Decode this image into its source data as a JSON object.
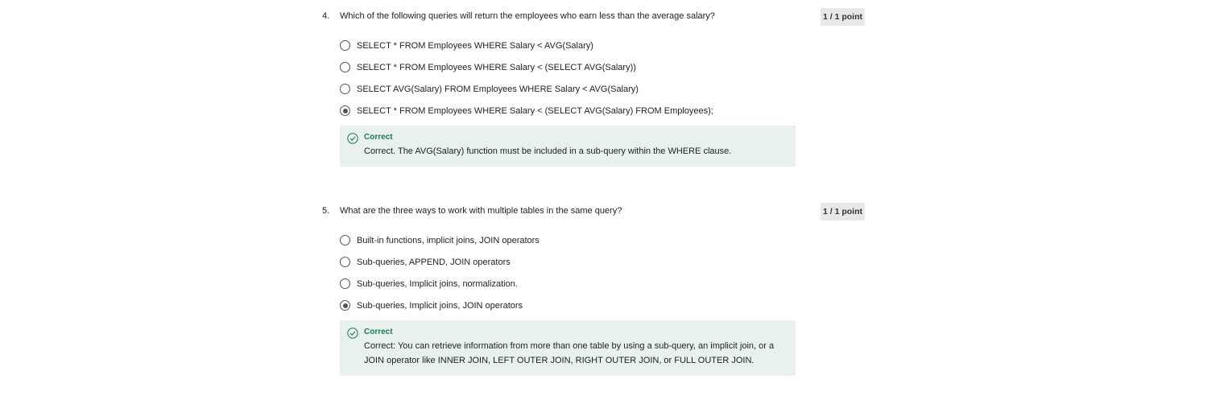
{
  "questions": [
    {
      "number": "4.",
      "text": "Which of the following queries will return the employees who earn less than the average salary?",
      "points": "1 / 1 point",
      "options": [
        {
          "label": "SELECT * FROM Employees WHERE Salary < AVG(Salary)",
          "selected": false
        },
        {
          "label": "SELECT * FROM Employees WHERE Salary < (SELECT AVG(Salary))",
          "selected": false
        },
        {
          "label": "SELECT AVG(Salary) FROM Employees WHERE Salary < AVG(Salary)",
          "selected": false
        },
        {
          "label": "SELECT * FROM Employees WHERE Salary < (SELECT AVG(Salary) FROM Employees);",
          "selected": true
        }
      ],
      "feedback": {
        "title": "Correct",
        "text": "Correct. The AVG(Salary) function must be included in a sub-query within the WHERE clause.",
        "icon": "check-circle-icon"
      }
    },
    {
      "number": "5.",
      "text": "What are the three ways to work with multiple tables in the same query?",
      "points": "1 / 1 point",
      "options": [
        {
          "label": "Built-in functions, implicit joins, JOIN operators",
          "selected": false
        },
        {
          "label": "Sub-queries, APPEND, JOIN operators",
          "selected": false
        },
        {
          "label": "Sub-queries, Implicit joins, normalization.",
          "selected": false
        },
        {
          "label": "Sub-queries, Implicit joins, JOIN operators",
          "selected": true
        }
      ],
      "feedback": {
        "title": "Correct",
        "text": "Correct: You can retrieve information from more than one table by using a sub-query, an implicit join, or a JOIN operator like INNER JOIN, LEFT OUTER JOIN, RIGHT OUTER JOIN, or FULL OUTER JOIN.",
        "icon": "check-circle-icon"
      }
    }
  ],
  "colors": {
    "feedback_bg": "#e8f1ed",
    "correct_green": "#1e7a4e",
    "points_badge_bg": "#e8e8e8"
  }
}
